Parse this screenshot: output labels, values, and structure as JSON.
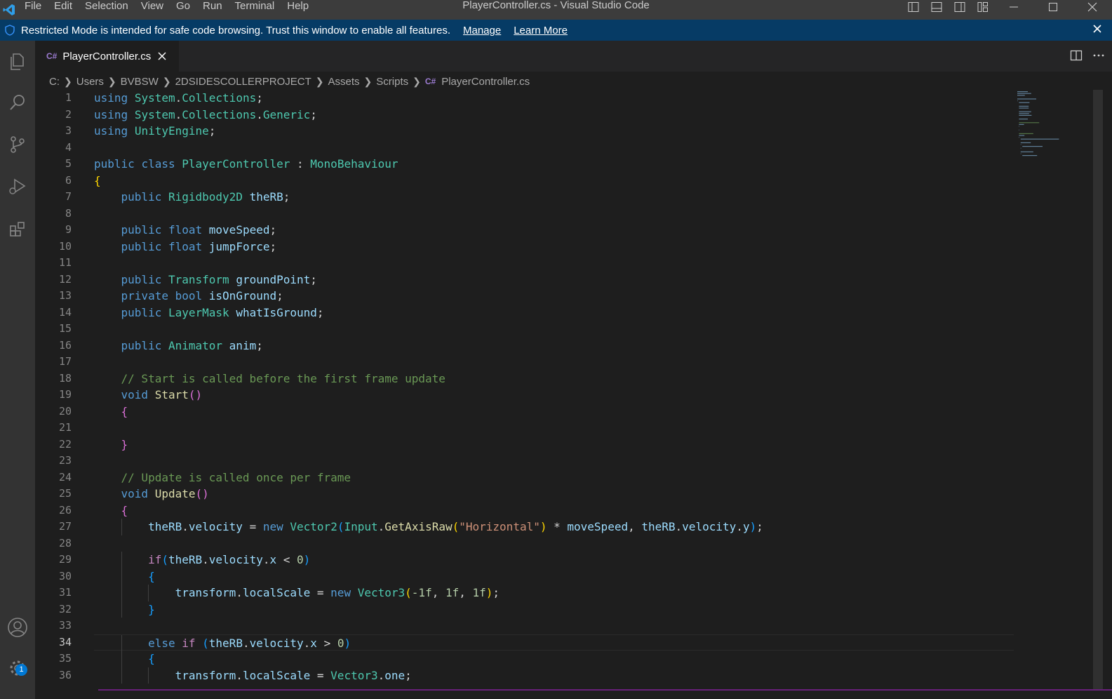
{
  "titlebar": {
    "menu": [
      "File",
      "Edit",
      "Selection",
      "View",
      "Go",
      "Run",
      "Terminal",
      "Help"
    ],
    "title": "PlayerController.cs - Visual Studio Code"
  },
  "banner": {
    "message": "Restricted Mode is intended for safe code browsing. Trust this window to enable all features.",
    "manage": "Manage",
    "learn_more": "Learn More"
  },
  "activity": {
    "settings_badge": "1"
  },
  "tab": {
    "icon_text": "C#",
    "label": "PlayerController.cs"
  },
  "breadcrumb": {
    "items": [
      "C:",
      "Users",
      "BVBSW",
      "2DSIDESCOLLERPROJECT",
      "Assets",
      "Scripts"
    ],
    "file": "PlayerController.cs"
  },
  "editor": {
    "active_line": 34,
    "line_numbers": [
      1,
      2,
      3,
      4,
      5,
      6,
      7,
      8,
      9,
      10,
      11,
      12,
      13,
      14,
      15,
      16,
      17,
      18,
      19,
      20,
      21,
      22,
      23,
      24,
      25,
      26,
      27,
      28,
      29,
      30,
      31,
      32,
      33,
      34,
      35,
      36
    ],
    "lines": [
      "using System.Collections;",
      "using System.Collections.Generic;",
      "using UnityEngine;",
      "",
      "public class PlayerController : MonoBehaviour",
      "{",
      "    public Rigidbody2D theRB;",
      "",
      "    public float moveSpeed;",
      "    public float jumpForce;",
      "",
      "    public Transform groundPoint;",
      "    private bool isOnGround;",
      "    public LayerMask whatIsGround;",
      "",
      "    public Animator anim;",
      "",
      "    // Start is called before the first frame update",
      "    void Start()",
      "    {",
      "",
      "    }",
      "",
      "    // Update is called once per frame",
      "    void Update()",
      "    {",
      "        theRB.velocity = new Vector2(Input.GetAxisRaw(\"Horizontal\") * moveSpeed, theRB.velocity.y);",
      "",
      "        if(theRB.velocity.x < 0)",
      "        {",
      "            transform.localScale = new Vector3(-1f, 1f, 1f);",
      "        }",
      "",
      "        else if (theRB.velocity.x > 0)",
      "        {",
      "            transform.localScale = Vector3.one;"
    ]
  },
  "colors": {
    "titlebar_bg": "#3c3c3c",
    "banner_bg": "#063b65",
    "activity_bg": "#333333",
    "editor_bg": "#1e1e1e",
    "accent": "#0078d4"
  }
}
